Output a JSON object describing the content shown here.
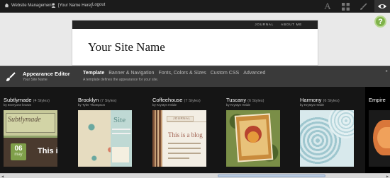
{
  "topbar": {
    "website_management": "Website Management",
    "user_name": "[Your Name Here]",
    "logout": "Logout",
    "font_icon": "A",
    "colors": {
      "bg": "#1b1b1b"
    }
  },
  "site": {
    "nav": [
      "JOURNAL",
      "ABOUT ME"
    ],
    "title": "Your Site Name"
  },
  "help": {
    "label": "?"
  },
  "editor": {
    "title": "Appearance Editor",
    "subtitle": "Your Site Name",
    "tabs": [
      {
        "label": "Template",
        "active": true
      },
      {
        "label": "Banner & Navigation",
        "active": false
      },
      {
        "label": "Fonts, Colors & Sizes",
        "active": false
      },
      {
        "label": "Custom CSS",
        "active": false
      },
      {
        "label": "Advanced",
        "active": false
      }
    ],
    "description": "A template defines the appearance for your site."
  },
  "themes": [
    {
      "name": "Subtlymade",
      "count": "(4 Styles)",
      "author": "by Everyone knows",
      "thumb": {
        "banner": "Subtlymade",
        "month": "06",
        "day": "may",
        "heading": "This i"
      }
    },
    {
      "name": "Brooklyn",
      "count": "(7 Styles)",
      "author": "by Tyler Thompson",
      "thumb": {
        "text": "Site"
      }
    },
    {
      "name": "Coffeehouse",
      "count": "(7 Styles)",
      "author": "by Krystyn Heide",
      "thumb": {
        "tab": "JOURNAL",
        "heading": "This is a blog"
      }
    },
    {
      "name": "Tuscany",
      "count": "(6 Styles)",
      "author": "by Krystyn Heide",
      "thumb": {}
    },
    {
      "name": "Harmony",
      "count": "(6 Styles)",
      "author": "by Krystyn Heide",
      "thumb": {}
    },
    {
      "name": "Empire",
      "count": "",
      "author": "",
      "thumb": {}
    }
  ]
}
